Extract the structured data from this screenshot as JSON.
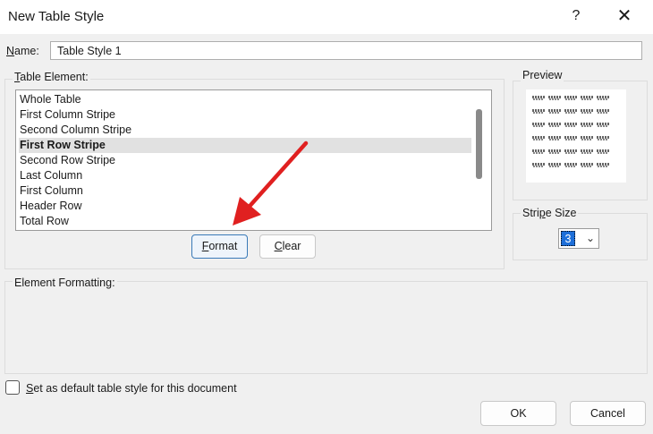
{
  "window": {
    "title": "New Table Style",
    "help_label": "?",
    "close_label": "✕"
  },
  "name_field": {
    "label": "Name:",
    "value": "Table Style 1"
  },
  "table_element": {
    "label": "Table Element:",
    "items": [
      {
        "label": "Whole Table",
        "selected": false
      },
      {
        "label": "First Column Stripe",
        "selected": false
      },
      {
        "label": "Second Column Stripe",
        "selected": false
      },
      {
        "label": "First Row Stripe",
        "selected": true
      },
      {
        "label": "Second Row Stripe",
        "selected": false
      },
      {
        "label": "Last Column",
        "selected": false
      },
      {
        "label": "First Column",
        "selected": false
      },
      {
        "label": "Header Row",
        "selected": false
      },
      {
        "label": "Total Row",
        "selected": false
      }
    ],
    "format_button": "Format",
    "clear_button": "Clear"
  },
  "preview": {
    "label": "Preview",
    "rows": 6,
    "cols": 5
  },
  "stripe_size": {
    "label": "Stripe Size",
    "value": "3"
  },
  "element_formatting": {
    "label": "Element Formatting:"
  },
  "default_checkbox": {
    "label": "Set as default table style for this document",
    "checked": false
  },
  "footer": {
    "ok_label": "OK",
    "cancel_label": "Cancel"
  },
  "annotation": {
    "arrow_color": "#e02020"
  }
}
